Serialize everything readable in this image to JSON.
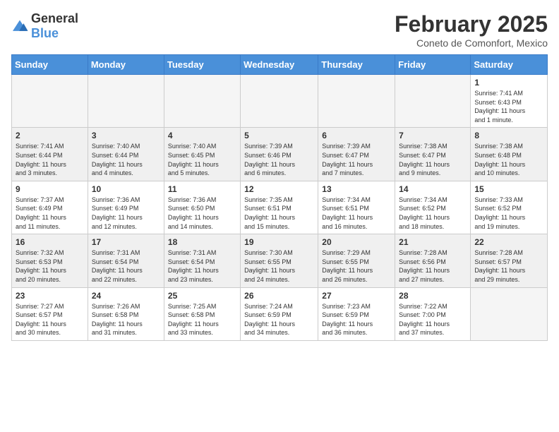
{
  "header": {
    "logo": {
      "general": "General",
      "blue": "Blue"
    },
    "title": "February 2025",
    "subtitle": "Coneto de Comonfort, Mexico"
  },
  "days_of_week": [
    "Sunday",
    "Monday",
    "Tuesday",
    "Wednesday",
    "Thursday",
    "Friday",
    "Saturday"
  ],
  "weeks": [
    {
      "shaded": false,
      "days": [
        {
          "num": "",
          "info": ""
        },
        {
          "num": "",
          "info": ""
        },
        {
          "num": "",
          "info": ""
        },
        {
          "num": "",
          "info": ""
        },
        {
          "num": "",
          "info": ""
        },
        {
          "num": "",
          "info": ""
        },
        {
          "num": "1",
          "info": "Sunrise: 7:41 AM\nSunset: 6:43 PM\nDaylight: 11 hours\nand 1 minute."
        }
      ]
    },
    {
      "shaded": true,
      "days": [
        {
          "num": "2",
          "info": "Sunrise: 7:41 AM\nSunset: 6:44 PM\nDaylight: 11 hours\nand 3 minutes."
        },
        {
          "num": "3",
          "info": "Sunrise: 7:40 AM\nSunset: 6:44 PM\nDaylight: 11 hours\nand 4 minutes."
        },
        {
          "num": "4",
          "info": "Sunrise: 7:40 AM\nSunset: 6:45 PM\nDaylight: 11 hours\nand 5 minutes."
        },
        {
          "num": "5",
          "info": "Sunrise: 7:39 AM\nSunset: 6:46 PM\nDaylight: 11 hours\nand 6 minutes."
        },
        {
          "num": "6",
          "info": "Sunrise: 7:39 AM\nSunset: 6:47 PM\nDaylight: 11 hours\nand 7 minutes."
        },
        {
          "num": "7",
          "info": "Sunrise: 7:38 AM\nSunset: 6:47 PM\nDaylight: 11 hours\nand 9 minutes."
        },
        {
          "num": "8",
          "info": "Sunrise: 7:38 AM\nSunset: 6:48 PM\nDaylight: 11 hours\nand 10 minutes."
        }
      ]
    },
    {
      "shaded": false,
      "days": [
        {
          "num": "9",
          "info": "Sunrise: 7:37 AM\nSunset: 6:49 PM\nDaylight: 11 hours\nand 11 minutes."
        },
        {
          "num": "10",
          "info": "Sunrise: 7:36 AM\nSunset: 6:49 PM\nDaylight: 11 hours\nand 12 minutes."
        },
        {
          "num": "11",
          "info": "Sunrise: 7:36 AM\nSunset: 6:50 PM\nDaylight: 11 hours\nand 14 minutes."
        },
        {
          "num": "12",
          "info": "Sunrise: 7:35 AM\nSunset: 6:51 PM\nDaylight: 11 hours\nand 15 minutes."
        },
        {
          "num": "13",
          "info": "Sunrise: 7:34 AM\nSunset: 6:51 PM\nDaylight: 11 hours\nand 16 minutes."
        },
        {
          "num": "14",
          "info": "Sunrise: 7:34 AM\nSunset: 6:52 PM\nDaylight: 11 hours\nand 18 minutes."
        },
        {
          "num": "15",
          "info": "Sunrise: 7:33 AM\nSunset: 6:52 PM\nDaylight: 11 hours\nand 19 minutes."
        }
      ]
    },
    {
      "shaded": true,
      "days": [
        {
          "num": "16",
          "info": "Sunrise: 7:32 AM\nSunset: 6:53 PM\nDaylight: 11 hours\nand 20 minutes."
        },
        {
          "num": "17",
          "info": "Sunrise: 7:31 AM\nSunset: 6:54 PM\nDaylight: 11 hours\nand 22 minutes."
        },
        {
          "num": "18",
          "info": "Sunrise: 7:31 AM\nSunset: 6:54 PM\nDaylight: 11 hours\nand 23 minutes."
        },
        {
          "num": "19",
          "info": "Sunrise: 7:30 AM\nSunset: 6:55 PM\nDaylight: 11 hours\nand 24 minutes."
        },
        {
          "num": "20",
          "info": "Sunrise: 7:29 AM\nSunset: 6:55 PM\nDaylight: 11 hours\nand 26 minutes."
        },
        {
          "num": "21",
          "info": "Sunrise: 7:28 AM\nSunset: 6:56 PM\nDaylight: 11 hours\nand 27 minutes."
        },
        {
          "num": "22",
          "info": "Sunrise: 7:28 AM\nSunset: 6:57 PM\nDaylight: 11 hours\nand 29 minutes."
        }
      ]
    },
    {
      "shaded": false,
      "days": [
        {
          "num": "23",
          "info": "Sunrise: 7:27 AM\nSunset: 6:57 PM\nDaylight: 11 hours\nand 30 minutes."
        },
        {
          "num": "24",
          "info": "Sunrise: 7:26 AM\nSunset: 6:58 PM\nDaylight: 11 hours\nand 31 minutes."
        },
        {
          "num": "25",
          "info": "Sunrise: 7:25 AM\nSunset: 6:58 PM\nDaylight: 11 hours\nand 33 minutes."
        },
        {
          "num": "26",
          "info": "Sunrise: 7:24 AM\nSunset: 6:59 PM\nDaylight: 11 hours\nand 34 minutes."
        },
        {
          "num": "27",
          "info": "Sunrise: 7:23 AM\nSunset: 6:59 PM\nDaylight: 11 hours\nand 36 minutes."
        },
        {
          "num": "28",
          "info": "Sunrise: 7:22 AM\nSunset: 7:00 PM\nDaylight: 11 hours\nand 37 minutes."
        },
        {
          "num": "",
          "info": ""
        }
      ]
    }
  ]
}
